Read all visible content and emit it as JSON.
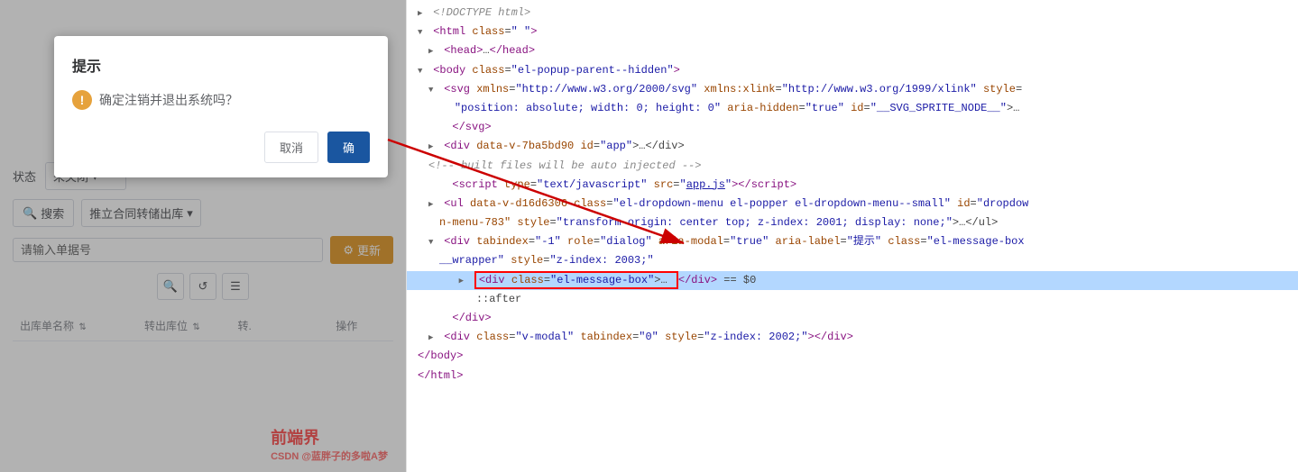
{
  "dialog": {
    "title": "提示",
    "message": "确定注销并退出系统吗？",
    "cancel_label": "取消",
    "confirm_label": "确"
  },
  "left_panel": {
    "status_label": "状态",
    "status_value": "未关闭",
    "search_button": "搜索",
    "warehouse_placeholder": "推立合同转储出库",
    "order_placeholder": "请输入单据号",
    "refresh_button": "更新",
    "columns": {
      "name": "出库单名称",
      "from_warehouse": "转出库位",
      "to": "转.",
      "operation": "操作"
    }
  },
  "code_panel": {
    "lines": [
      {
        "id": 1,
        "indent": 0,
        "content": "<!DOCTYPE html>"
      },
      {
        "id": 2,
        "indent": 0,
        "content": "<html class=\" \">"
      },
      {
        "id": 3,
        "indent": 1,
        "content": "<head>…</head>",
        "collapsed": true
      },
      {
        "id": 4,
        "indent": 0,
        "content": "<body class=\"el-popup-parent--hidden\">",
        "expanded": true
      },
      {
        "id": 5,
        "indent": 1,
        "content": "<svg xmlns=\"http://www.w3.org/2000/svg\" xmlns:xlink=\"http://www.w3.org/1999/xlink\" style=\"position: absolute; width: 0; height: 0\" aria-hidden=\"true\" id=\"__SVG_SPRITE_NODE__\">…",
        "expanded": true
      },
      {
        "id": 6,
        "indent": 2,
        "content": "</svg>"
      },
      {
        "id": 7,
        "indent": 1,
        "content": "<div data-v-7ba5bd90 id=\"app\">…</div>"
      },
      {
        "id": 8,
        "indent": 1,
        "content": "<!-- built files will be auto injected -->"
      },
      {
        "id": 9,
        "indent": 2,
        "content": "<script type=\"text/javascript\" src=\"app.js\"></script>"
      },
      {
        "id": 10,
        "indent": 1,
        "content": "<ul data-v-d16d6306 class=\"el-dropdown-menu el-popper el-dropdown-menu--small\" id=\"dropdown-menu-783\" style=\"transform-origin: center top; z-index: 2001; display: none;\">…</ul>"
      },
      {
        "id": 11,
        "indent": 1,
        "content": "<div tabindex=\"-1\" role=\"dialog\" aria-modal=\"true\" aria-label=\"提示\" class=\"el-message-box__wrapper\" style=\"z-index: 2003;\"",
        "expanded": true
      },
      {
        "id": 12,
        "indent": 2,
        "content": "<div class=\"el-message-box\">…</div> == $0",
        "highlighted": true
      },
      {
        "id": 13,
        "indent": 3,
        "content": "::after"
      },
      {
        "id": 14,
        "indent": 2,
        "content": "</div>"
      },
      {
        "id": 15,
        "indent": 1,
        "content": "<div class=\"v-modal\" tabindex=\"0\" style=\"z-index: 2002;\"></div>"
      },
      {
        "id": 16,
        "indent": 0,
        "content": "</body>"
      },
      {
        "id": 17,
        "indent": 0,
        "content": "</html>"
      }
    ]
  },
  "watermark": {
    "main": "前端界",
    "sub": "CSDN @蓝胖子的多啦A梦"
  }
}
